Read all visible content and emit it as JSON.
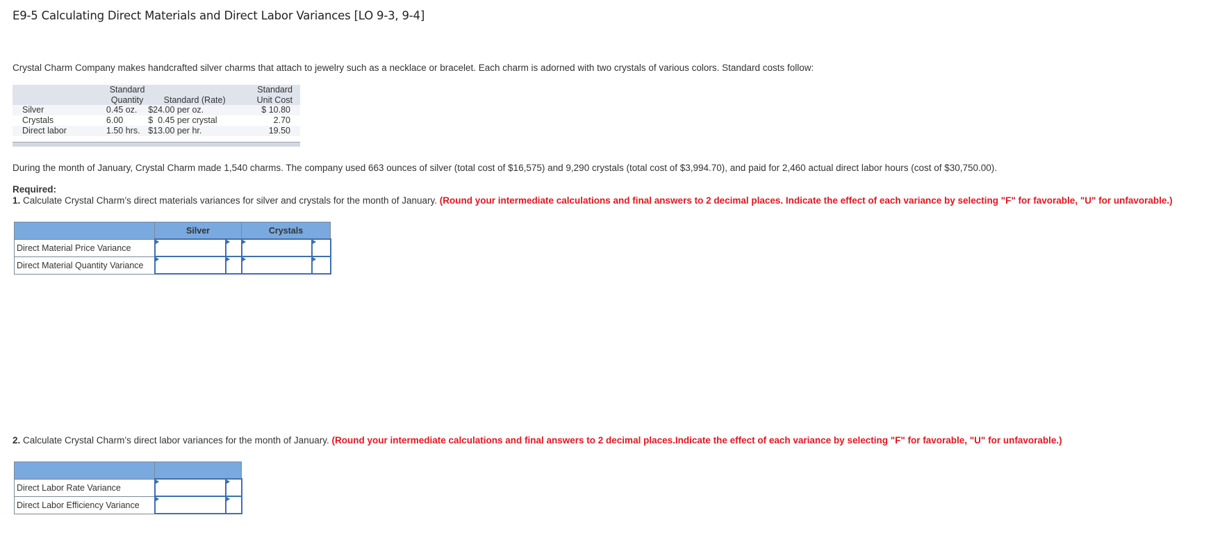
{
  "title": "E9-5 Calculating Direct Materials and Direct Labor Variances [LO 9-3, 9-4]",
  "intro": "Crystal Charm Company makes handcrafted silver charms that attach to jewelry such as a necklace or bracelet. Each charm is adorned with two crystals of various colors. Standard costs follow:",
  "standard_costs": {
    "headers": {
      "qty_line1": "Standard",
      "qty_line2": "Quantity",
      "rate": "Standard (Rate)",
      "cost_line1": "Standard",
      "cost_line2": "Unit Cost"
    },
    "rows": [
      {
        "label": "Silver",
        "qty": "0.45 oz.",
        "rate": "$24.00 per oz.",
        "cost": "$ 10.80"
      },
      {
        "label": "Crystals",
        "qty": "6.00",
        "rate": "$  0.45 per crystal",
        "cost": "2.70"
      },
      {
        "label": "Direct labor",
        "qty": "1.50 hrs.",
        "rate": "$13.00 per hr.",
        "cost": "19.50"
      }
    ]
  },
  "facts": "During the month of January, Crystal Charm made 1,540 charms. The company used 663 ounces of silver (total cost of $16,575) and 9,290 crystals (total cost of $3,994.70), and paid for 2,460 actual direct labor hours (cost of $30,750.00).",
  "required_label": "Required:",
  "q1": {
    "number": "1.",
    "text": " Calculate Crystal Charm’s direct materials variances for silver and crystals for the month of January. ",
    "instruction": "(Round your intermediate calculations and final answers to 2 decimal places. Indicate the effect of each variance by selecting \"F\" for favorable, \"U\" for unfavorable.)",
    "table": {
      "columns": [
        "Silver",
        "Crystals"
      ],
      "rows": [
        {
          "label": "Direct Material Price Variance",
          "silver_value": "",
          "silver_effect": "",
          "crystals_value": "",
          "crystals_effect": ""
        },
        {
          "label": "Direct Material Quantity Variance",
          "silver_value": "",
          "silver_effect": "",
          "crystals_value": "",
          "crystals_effect": ""
        }
      ]
    }
  },
  "q2": {
    "number": "2.",
    "text": " Calculate Crystal Charm’s direct labor variances for the month of January. ",
    "instruction": "(Round your intermediate calculations and final answers to 2 decimal places.Indicate the effect of each variance by selecting \"F\" for favorable, \"U\" for unfavorable.)",
    "table": {
      "rows": [
        {
          "label": "Direct Labor Rate Variance",
          "value": "",
          "effect": ""
        },
        {
          "label": "Direct Labor Efficiency Variance",
          "value": "",
          "effect": ""
        }
      ]
    }
  },
  "colors": {
    "header_blue": "#79a9de",
    "instruction_red": "#e8141c",
    "input_border": "#3f6fb0",
    "std_table_header": "#dfe3ec"
  }
}
